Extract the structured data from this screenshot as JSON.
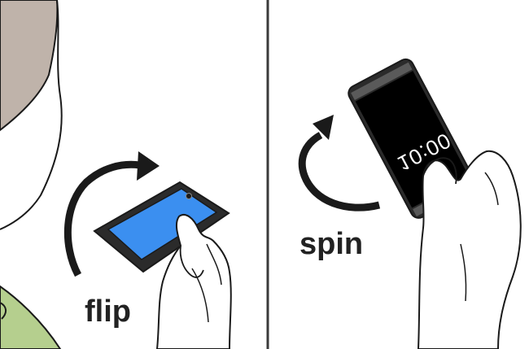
{
  "panels": [
    {
      "caption": "flip",
      "gesture": "flip",
      "screen_color": "#3b8ff0",
      "skin_color": "#bfb3aa",
      "sleeve_color": "#b5cf8e"
    },
    {
      "caption": "spin",
      "gesture": "spin",
      "screen_color": "#000000",
      "clock_text": "10:00"
    }
  ],
  "colors": {
    "outline": "#1a1a1a",
    "divider": "#3a3a3a",
    "phone_bezel": "#2b2b2b",
    "phone_bar": "#5a5a5a",
    "arrow": "#1a1a1a"
  },
  "icons": [
    "curved-arrow-icon",
    "curved-arrow-icon"
  ]
}
